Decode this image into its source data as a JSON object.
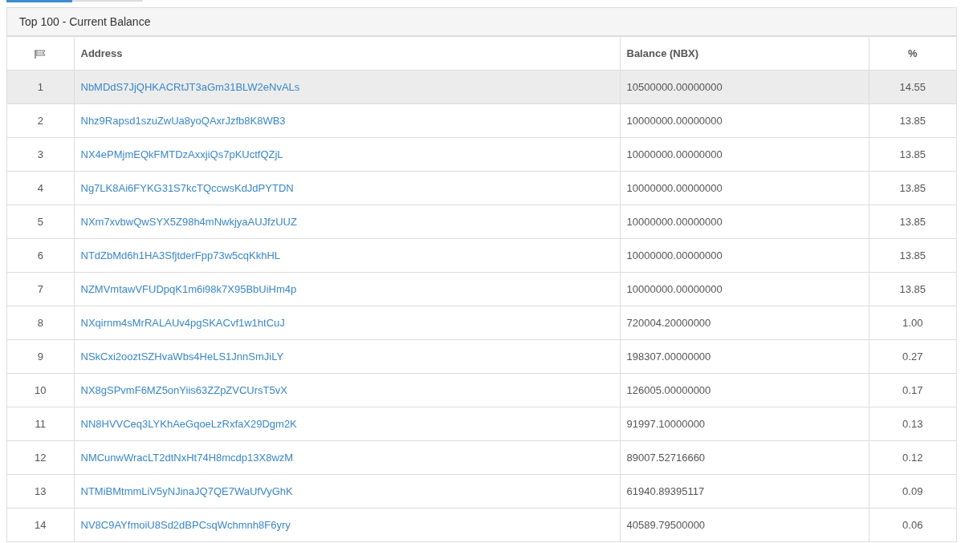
{
  "tabs": [
    {
      "selected": true
    },
    {
      "selected": false
    }
  ],
  "panel": {
    "title": "Top 100 - Current Balance"
  },
  "table": {
    "columns": [
      "Address",
      "Balance (NBX)",
      "%"
    ],
    "rows": [
      {
        "rank": "1",
        "address": "NbMDdS7JjQHKACRtJT3aGm31BLW2eNvALs",
        "balance": "10500000.00000000",
        "percent": "14.55",
        "highlighted": true
      },
      {
        "rank": "2",
        "address": "Nhz9Rapsd1szuZwUa8yoQAxrJzfb8K8WB3",
        "balance": "10000000.00000000",
        "percent": "13.85",
        "highlighted": false
      },
      {
        "rank": "3",
        "address": "NX4ePMjmEQkFMTDzAxxjiQs7pKUctfQZjL",
        "balance": "10000000.00000000",
        "percent": "13.85",
        "highlighted": false
      },
      {
        "rank": "4",
        "address": "Ng7LK8Ai6FYKG31S7kcTQccwsKdJdPYTDN",
        "balance": "10000000.00000000",
        "percent": "13.85",
        "highlighted": false
      },
      {
        "rank": "5",
        "address": "NXm7xvbwQwSYX5Z98h4mNwkjyaAUJfzUUZ",
        "balance": "10000000.00000000",
        "percent": "13.85",
        "highlighted": false
      },
      {
        "rank": "6",
        "address": "NTdZbMd6h1HA3SfjtderFpp73w5cqKkhHL",
        "balance": "10000000.00000000",
        "percent": "13.85",
        "highlighted": false
      },
      {
        "rank": "7",
        "address": "NZMVmtawVFUDpqK1m6i98k7X95BbUiHm4p",
        "balance": "10000000.00000000",
        "percent": "13.85",
        "highlighted": false
      },
      {
        "rank": "8",
        "address": "NXqirnm4sMrRALAUv4pgSKACvf1w1htCuJ",
        "balance": "720004.20000000",
        "percent": "1.00",
        "highlighted": false
      },
      {
        "rank": "9",
        "address": "NSkCxi2ooztSZHvaWbs4HeLS1JnnSmJiLY",
        "balance": "198307.00000000",
        "percent": "0.27",
        "highlighted": false
      },
      {
        "rank": "10",
        "address": "NX8gSPvmF6MZ5onYiis63ZZpZVCUrsT5vX",
        "balance": "126005.00000000",
        "percent": "0.17",
        "highlighted": false
      },
      {
        "rank": "11",
        "address": "NN8HVVCeq3LYKhAeGqoeLzRxfaX29Dgm2K",
        "balance": "91997.10000000",
        "percent": "0.13",
        "highlighted": false
      },
      {
        "rank": "12",
        "address": "NMCunwWracLT2dtNxHt74H8mcdp13X8wzM",
        "balance": "89007.52716660",
        "percent": "0.12",
        "highlighted": false
      },
      {
        "rank": "13",
        "address": "NTMiBMtmmLiV5yNJinaJQ7QE7WaUfVyGhK",
        "balance": "61940.89395117",
        "percent": "0.09",
        "highlighted": false
      },
      {
        "rank": "14",
        "address": "NV8C9AYfmoiU8Sd2dBPCsqWchmnh8F6yry",
        "balance": "40589.79500000",
        "percent": "0.06",
        "highlighted": false
      }
    ]
  }
}
